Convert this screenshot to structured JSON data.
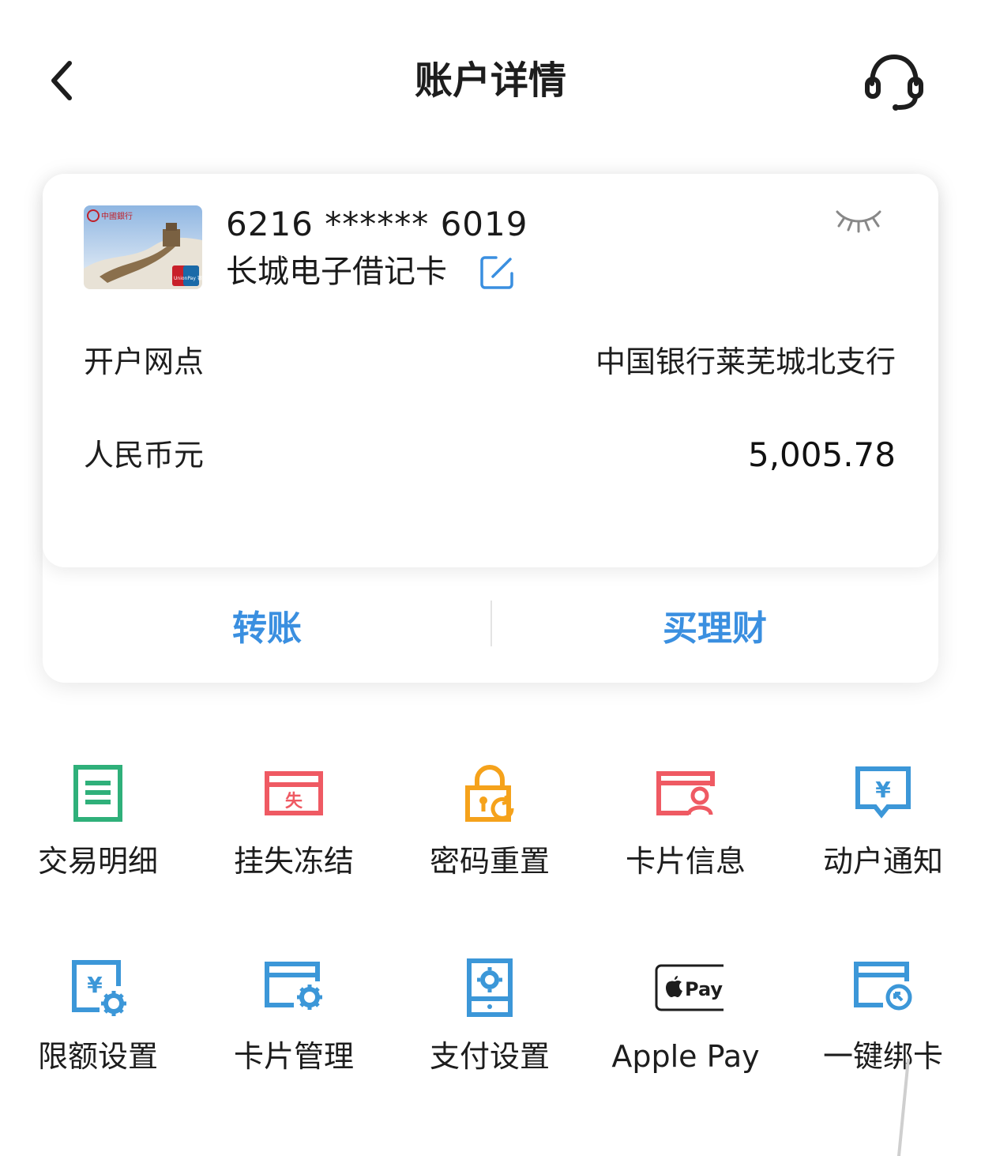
{
  "header": {
    "title": "账户详情",
    "back_icon": "chevron-left-icon",
    "service_icon": "headset-icon"
  },
  "account": {
    "card_number": "6216 ****** 6019",
    "card_name": "长城电子借记卡",
    "branch_label": "开户网点",
    "branch_value": "中国银行莱芜城北支行",
    "currency_label": "人民币元",
    "balance": "5,005.78",
    "card_logo_text": "中國銀行",
    "card_network_text": "UnionPay 银联"
  },
  "actions": {
    "transfer": "转账",
    "wealth": "买理财"
  },
  "services": [
    {
      "label": "交易明细",
      "icon": "transaction-list-icon"
    },
    {
      "label": "挂失冻结",
      "icon": "report-loss-icon"
    },
    {
      "label": "密码重置",
      "icon": "password-reset-icon"
    },
    {
      "label": "卡片信息",
      "icon": "card-info-icon"
    },
    {
      "label": "动户通知",
      "icon": "account-notice-icon"
    },
    {
      "label": "限额设置",
      "icon": "limit-settings-icon"
    },
    {
      "label": "卡片管理",
      "icon": "card-management-icon"
    },
    {
      "label": "支付设置",
      "icon": "payment-settings-icon"
    },
    {
      "label": "Apple Pay",
      "icon": "apple-pay-icon"
    },
    {
      "label": "一键绑卡",
      "icon": "one-click-bind-icon"
    }
  ],
  "colors": {
    "accent_blue": "#3a8fe0",
    "green": "#2fb07a",
    "red": "#ef5a63",
    "orange": "#f5a21b",
    "steel_blue": "#3c97d8"
  }
}
